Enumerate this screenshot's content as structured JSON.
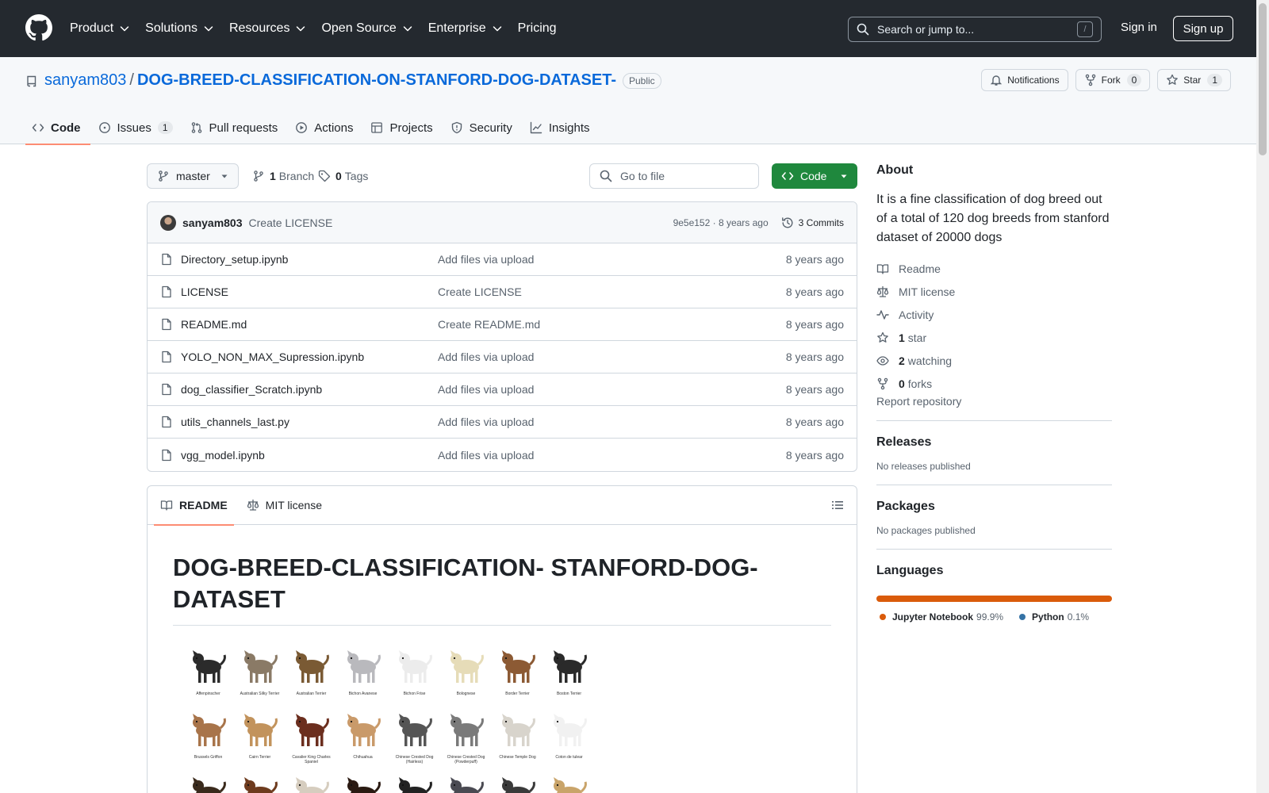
{
  "header": {
    "nav": [
      {
        "label": "Product",
        "has_menu": true
      },
      {
        "label": "Solutions",
        "has_menu": true
      },
      {
        "label": "Resources",
        "has_menu": true
      },
      {
        "label": "Open Source",
        "has_menu": true
      },
      {
        "label": "Enterprise",
        "has_menu": true
      },
      {
        "label": "Pricing",
        "has_menu": false
      }
    ],
    "search_placeholder": "Search or jump to...",
    "search_key": "/",
    "sign_in": "Sign in",
    "sign_up": "Sign up"
  },
  "repo": {
    "owner": "sanyam803",
    "separator": "/",
    "name": "DOG-BREED-CLASSIFICATION-ON-STANFORD-DOG-DATASET-",
    "visibility": "Public",
    "notifications_label": "Notifications",
    "fork_label": "Fork",
    "fork_count": "0",
    "star_label": "Star",
    "star_count": "1",
    "tabs": [
      {
        "label": "Code",
        "icon": "code-icon",
        "active": true,
        "count": ""
      },
      {
        "label": "Issues",
        "icon": "issue-icon",
        "active": false,
        "count": "1"
      },
      {
        "label": "Pull requests",
        "icon": "pull-request-icon",
        "active": false,
        "count": ""
      },
      {
        "label": "Actions",
        "icon": "play-icon",
        "active": false,
        "count": ""
      },
      {
        "label": "Projects",
        "icon": "table-icon",
        "active": false,
        "count": ""
      },
      {
        "label": "Security",
        "icon": "shield-icon",
        "active": false,
        "count": ""
      },
      {
        "label": "Insights",
        "icon": "graph-icon",
        "active": false,
        "count": ""
      }
    ]
  },
  "toolbar": {
    "branch": "master",
    "branch_count": "1",
    "branch_label": "Branch",
    "tag_count": "0",
    "tag_label": "Tags",
    "goto_placeholder": "Go to file",
    "code_label": "Code"
  },
  "commit": {
    "user": "sanyam803",
    "message": "Create LICENSE",
    "meta": "9e5e152 · 8 years ago",
    "count_label": "3 Commits"
  },
  "files": [
    {
      "name": "Directory_setup.ipynb",
      "message": "Add files via upload",
      "age": "8 years ago"
    },
    {
      "name": "LICENSE",
      "message": "Create LICENSE",
      "age": "8 years ago"
    },
    {
      "name": "README.md",
      "message": "Create README.md",
      "age": "8 years ago"
    },
    {
      "name": "YOLO_NON_MAX_Supression.ipynb",
      "message": "Add files via upload",
      "age": "8 years ago"
    },
    {
      "name": "dog_classifier_Scratch.ipynb",
      "message": "Add files via upload",
      "age": "8 years ago"
    },
    {
      "name": "utils_channels_last.py",
      "message": "Add files via upload",
      "age": "8 years ago"
    },
    {
      "name": "vgg_model.ipynb",
      "message": "Add files via upload",
      "age": "8 years ago"
    }
  ],
  "readme": {
    "tabs": [
      {
        "label": "README",
        "icon": "book-icon",
        "active": true
      },
      {
        "label": "MIT license",
        "icon": "law-icon",
        "active": false
      }
    ],
    "title": "DOG-BREED-CLASSIFICATION- STANFORD-DOG-DATASET",
    "breeds": [
      {
        "label": "Affenpinscher",
        "color": "#2b2b2b"
      },
      {
        "label": "Australian Silky Terrier",
        "color": "#8a7a66"
      },
      {
        "label": "Australian Terrier",
        "color": "#7a5a34"
      },
      {
        "label": "Bichon Avanese",
        "color": "#b9b9bd"
      },
      {
        "label": "Bichon Frise",
        "color": "#ececec"
      },
      {
        "label": "Bolognese",
        "color": "#e6dcb8"
      },
      {
        "label": "Border Terrier",
        "color": "#8c5a34"
      },
      {
        "label": "Boston Terrier",
        "color": "#2a2a2a"
      },
      {
        "label": "Brussels Griffon",
        "color": "#a8744a"
      },
      {
        "label": "Cairn Terrier",
        "color": "#c2935c"
      },
      {
        "label": "Cavalier King Charles Spaniel",
        "color": "#6b2e1e"
      },
      {
        "label": "Chihuahua",
        "color": "#c99a6a"
      },
      {
        "label": "Chinese Crested Dog (Hairless)",
        "color": "#555555"
      },
      {
        "label": "Chinese Crested Dog (Powderpuff)",
        "color": "#7a7a7a"
      },
      {
        "label": "Chinese Temple Dog",
        "color": "#d8d4cc"
      },
      {
        "label": "Coton de tulear",
        "color": "#f1f1f1"
      },
      {
        "label": "",
        "color": "#3a2a1c"
      },
      {
        "label": "",
        "color": "#6e3b1e"
      },
      {
        "label": "",
        "color": "#d6cdbf"
      },
      {
        "label": "",
        "color": "#2a1a12"
      },
      {
        "label": "",
        "color": "#222222"
      },
      {
        "label": "",
        "color": "#4a4a52"
      },
      {
        "label": "",
        "color": "#3a3a3a"
      },
      {
        "label": "",
        "color": "#c9a46a"
      }
    ]
  },
  "about": {
    "title": "About",
    "description": "It is a fine classification of dog breed out of a total of 120 dog breeds from stanford dataset of 20000 dogs",
    "links": [
      {
        "icon": "book-icon",
        "count": "",
        "label": "Readme"
      },
      {
        "icon": "law-icon",
        "count": "",
        "label": "MIT license"
      },
      {
        "icon": "pulse-icon",
        "count": "",
        "label": "Activity"
      },
      {
        "icon": "star-icon",
        "count": "1",
        "label": "star"
      },
      {
        "icon": "eye-icon",
        "count": "2",
        "label": "watching"
      },
      {
        "icon": "fork-icon",
        "count": "0",
        "label": "forks"
      }
    ],
    "report": "Report repository"
  },
  "releases": {
    "title": "Releases",
    "note": "No releases published"
  },
  "packages": {
    "title": "Packages",
    "note": "No packages published"
  },
  "languages": {
    "title": "Languages",
    "items": [
      {
        "name": "Jupyter Notebook",
        "percent": "99.9%",
        "value": 99.9,
        "color": "#DA5B0B"
      },
      {
        "name": "Python",
        "percent": "0.1%",
        "value": 0.1,
        "color": "#3572A5"
      }
    ]
  },
  "colors": {
    "header_bg": "#24292f",
    "link": "#0969da",
    "code_button": "#1f883d",
    "tab_underline": "#fd8c73"
  }
}
